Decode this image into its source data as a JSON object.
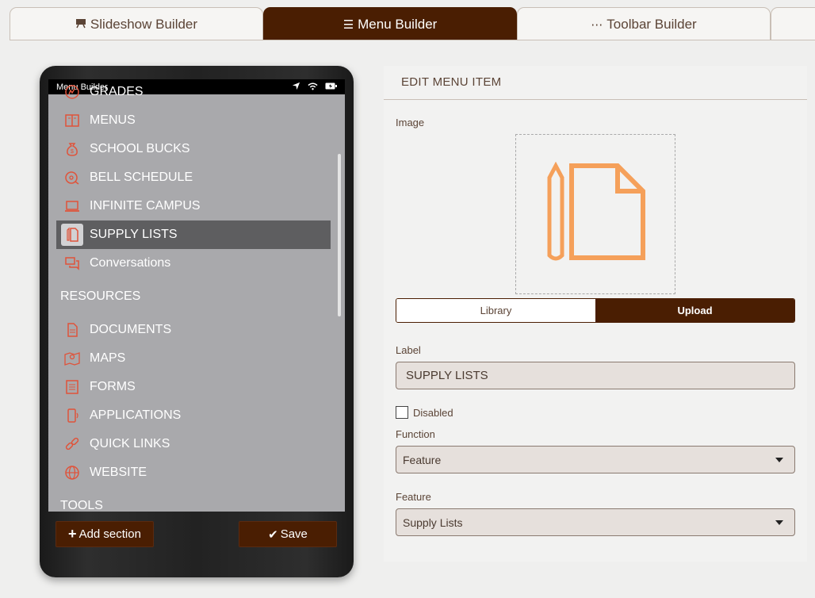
{
  "tabs": [
    {
      "label": "Slideshow Builder",
      "icon": "easel-icon"
    },
    {
      "label": "Menu Builder",
      "icon": "hamburger-icon"
    },
    {
      "label": "Toolbar Builder",
      "icon": "ellipsis-icon"
    }
  ],
  "phone": {
    "status_title": "Menu Builder",
    "items": [
      {
        "label": "GRADES",
        "icon": "grades-icon"
      },
      {
        "label": "MENUS",
        "icon": "menus-icon"
      },
      {
        "label": "SCHOOL BUCKS",
        "icon": "money-bag-icon"
      },
      {
        "label": "BELL SCHEDULE",
        "icon": "bell-icon"
      },
      {
        "label": "INFINITE CAMPUS",
        "icon": "laptop-icon"
      },
      {
        "label": "SUPPLY LISTS",
        "icon": "supply-list-icon"
      },
      {
        "label": "Conversations",
        "icon": "chat-icon"
      }
    ],
    "section_resources": "RESOURCES",
    "resource_items": [
      {
        "label": "DOCUMENTS",
        "icon": "document-icon"
      },
      {
        "label": "MAPS",
        "icon": "map-icon"
      },
      {
        "label": "FORMS",
        "icon": "form-icon"
      },
      {
        "label": "APPLICATIONS",
        "icon": "phone-app-icon"
      },
      {
        "label": "QUICK LINKS",
        "icon": "link-icon"
      },
      {
        "label": "WEBSITE",
        "icon": "globe-icon"
      }
    ],
    "section_tools": "TOOLS",
    "add_section": "Add section",
    "save": "Save"
  },
  "edit": {
    "title": "EDIT MENU ITEM",
    "image_label": "Image",
    "library": "Library",
    "upload": "Upload",
    "label_label": "Label",
    "label_value": "SUPPLY LISTS",
    "disabled_label": "Disabled",
    "function_label": "Function",
    "function_value": "Feature",
    "feature_label": "Feature",
    "feature_value": "Supply Lists"
  },
  "colors": {
    "brand": "#4a1e02",
    "icon_red": "#e0533a",
    "image_orange": "#f5a05a",
    "phone_bg": "#a9a9ac"
  }
}
